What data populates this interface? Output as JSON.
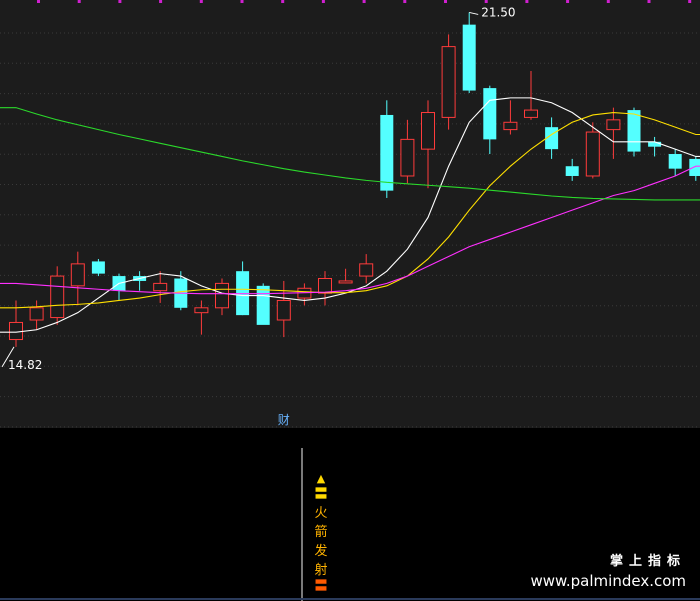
{
  "chart_data": {
    "type": "candlestick",
    "ylim": [
      13.5,
      21.55
    ],
    "candles": [
      {
        "o": 14.8,
        "h": 15.6,
        "l": 14.65,
        "c": 15.15
      },
      {
        "o": 15.2,
        "h": 15.6,
        "l": 15.0,
        "c": 15.45
      },
      {
        "o": 15.25,
        "h": 16.3,
        "l": 15.1,
        "c": 16.1
      },
      {
        "o": 15.9,
        "h": 16.6,
        "l": 15.5,
        "c": 16.35
      },
      {
        "o": 16.4,
        "h": 16.45,
        "l": 16.1,
        "c": 16.15
      },
      {
        "o": 16.1,
        "h": 16.15,
        "l": 15.6,
        "c": 15.8
      },
      {
        "o": 16.1,
        "h": 16.2,
        "l": 15.8,
        "c": 16.0
      },
      {
        "o": 15.8,
        "h": 16.2,
        "l": 15.55,
        "c": 15.95
      },
      {
        "o": 16.05,
        "h": 16.2,
        "l": 15.4,
        "c": 15.45
      },
      {
        "o": 15.35,
        "h": 15.6,
        "l": 14.9,
        "c": 15.45
      },
      {
        "o": 15.45,
        "h": 16.05,
        "l": 15.3,
        "c": 15.95
      },
      {
        "o": 16.2,
        "h": 16.4,
        "l": 15.3,
        "c": 15.3
      },
      {
        "o": 15.9,
        "h": 15.95,
        "l": 15.15,
        "c": 15.1
      },
      {
        "o": 15.2,
        "h": 16.0,
        "l": 14.85,
        "c": 15.6
      },
      {
        "o": 15.65,
        "h": 15.95,
        "l": 15.5,
        "c": 15.85
      },
      {
        "o": 15.75,
        "h": 16.2,
        "l": 15.5,
        "c": 16.05
      },
      {
        "o": 16.0,
        "h": 16.25,
        "l": 15.95,
        "c": 16.0
      },
      {
        "o": 16.1,
        "h": 16.55,
        "l": 15.95,
        "c": 16.35
      },
      {
        "o": 19.4,
        "h": 19.7,
        "l": 17.7,
        "c": 17.85
      },
      {
        "o": 18.15,
        "h": 19.3,
        "l": 18.0,
        "c": 18.9
      },
      {
        "o": 18.7,
        "h": 19.7,
        "l": 17.9,
        "c": 19.45
      },
      {
        "o": 19.35,
        "h": 21.05,
        "l": 19.1,
        "c": 20.8
      },
      {
        "o": 21.25,
        "h": 21.5,
        "l": 19.85,
        "c": 19.9
      },
      {
        "o": 19.95,
        "h": 20.0,
        "l": 18.6,
        "c": 18.9
      },
      {
        "o": 19.1,
        "h": 19.7,
        "l": 19.0,
        "c": 19.25
      },
      {
        "o": 19.35,
        "h": 20.3,
        "l": 19.3,
        "c": 19.5
      },
      {
        "o": 19.15,
        "h": 19.35,
        "l": 18.5,
        "c": 18.7
      },
      {
        "o": 18.35,
        "h": 18.5,
        "l": 18.05,
        "c": 18.15
      },
      {
        "o": 18.15,
        "h": 19.25,
        "l": 18.1,
        "c": 19.05
      },
      {
        "o": 19.1,
        "h": 19.55,
        "l": 18.5,
        "c": 19.3
      },
      {
        "o": 19.5,
        "h": 19.55,
        "l": 18.55,
        "c": 18.65
      },
      {
        "o": 18.85,
        "h": 18.95,
        "l": 18.55,
        "c": 18.75
      },
      {
        "o": 18.6,
        "h": 18.7,
        "l": 18.15,
        "c": 18.3
      },
      {
        "o": 18.5,
        "h": 18.55,
        "l": 18.05,
        "c": 18.15
      }
    ],
    "moving_averages": [
      {
        "color": "#ffffff",
        "values": [
          14.95,
          15.0,
          15.15,
          15.35,
          15.65,
          15.95,
          16.05,
          16.15,
          16.1,
          15.9,
          15.75,
          15.7,
          15.7,
          15.65,
          15.6,
          15.65,
          15.75,
          15.9,
          16.2,
          16.65,
          17.3,
          18.35,
          19.25,
          19.7,
          19.75,
          19.75,
          19.65,
          19.45,
          19.15,
          18.85,
          18.85,
          18.85,
          18.7,
          18.55
        ]
      },
      {
        "color": "#ffe000",
        "values": [
          15.45,
          15.47,
          15.5,
          15.52,
          15.55,
          15.6,
          15.65,
          15.72,
          15.78,
          15.82,
          15.83,
          15.83,
          15.82,
          15.8,
          15.78,
          15.76,
          15.76,
          15.8,
          15.9,
          16.1,
          16.45,
          16.9,
          17.45,
          17.95,
          18.35,
          18.7,
          19.0,
          19.25,
          19.4,
          19.45,
          19.42,
          19.3,
          19.15,
          19.0
        ]
      },
      {
        "color": "#ff30ff",
        "values": [
          15.95,
          15.92,
          15.89,
          15.86,
          15.83,
          15.8,
          15.78,
          15.76,
          15.75,
          15.74,
          15.74,
          15.74,
          15.74,
          15.75,
          15.76,
          15.77,
          15.8,
          15.85,
          15.95,
          16.1,
          16.3,
          16.5,
          16.7,
          16.85,
          17.0,
          17.15,
          17.3,
          17.45,
          17.6,
          17.75,
          17.85,
          18.0,
          18.15,
          18.35
        ]
      },
      {
        "color": "#2bd92b",
        "values": [
          19.55,
          19.42,
          19.3,
          19.2,
          19.1,
          19.0,
          18.91,
          18.82,
          18.73,
          18.64,
          18.55,
          18.46,
          18.38,
          18.3,
          18.23,
          18.17,
          18.11,
          18.06,
          18.02,
          17.99,
          17.96,
          17.93,
          17.9,
          17.86,
          17.82,
          17.78,
          17.74,
          17.71,
          17.69,
          17.68,
          17.67,
          17.66,
          17.66,
          17.66
        ]
      }
    ],
    "high_label": "21.50",
    "low_label": "14.82",
    "marker_label": "财",
    "up_color": "#ff3b3b",
    "down_color": "#54ffff"
  },
  "signal": {
    "arrow": "▲",
    "bar": "〓",
    "chars": [
      "火",
      "箭",
      "发",
      "射"
    ],
    "bottom": "〓",
    "color": "#ffb300"
  },
  "watermark": {
    "title": "掌上指标",
    "url": "www.palmindex.com"
  }
}
